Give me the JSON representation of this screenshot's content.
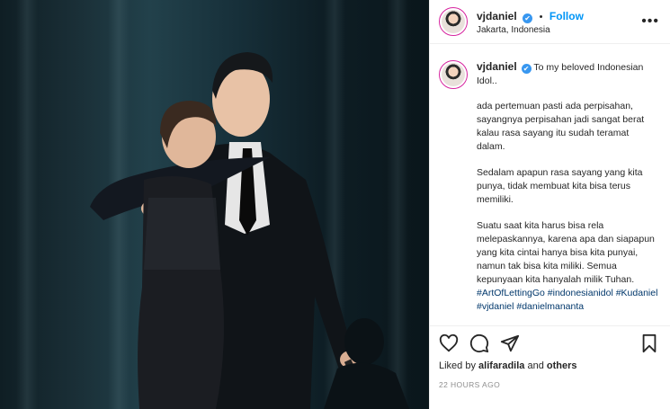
{
  "post": {
    "username": "vjdaniel",
    "follow_label": "Follow",
    "dot": "•",
    "location": "Jakarta, Indonesia",
    "more_label": "•••",
    "verified_glyph": "✔"
  },
  "caption": {
    "username": "vjdaniel",
    "first_line": "To my beloved Indonesian Idol..",
    "paragraph_1": "ada pertemuan pasti ada perpisahan, sayangnya perpisahan jadi sangat berat kalau rasa sayang itu sudah teramat dalam.",
    "paragraph_2": "Sedalam apapun rasa sayang yang kita punya, tidak membuat kita bisa terus memiliki.",
    "paragraph_3": "Suatu saat kita harus bisa rela melepaskannya, karena apa dan siapapun yang kita cintai hanya bisa kita punyai, namun tak bisa kita miliki. Semua kepunyaan kita hanyalah milik Tuhan.",
    "tags": [
      "#ArtOfLettingGo",
      "#indonesianidol",
      "#Kudaniel",
      "#vjdaniel",
      "#danielmananta"
    ]
  },
  "actions": {
    "icons": [
      "heart-icon",
      "comment-icon",
      "share-icon",
      "bookmark-icon"
    ],
    "liked_prefix": "Liked by",
    "liked_user": "alifaradila",
    "liked_and": "and",
    "liked_others": "others",
    "timestamp": "22 HOURS AGO"
  },
  "colors": {
    "link": "#0095f6",
    "hashtag": "#00376b",
    "muted": "#8e8e8e",
    "verified": "#3897f0"
  }
}
